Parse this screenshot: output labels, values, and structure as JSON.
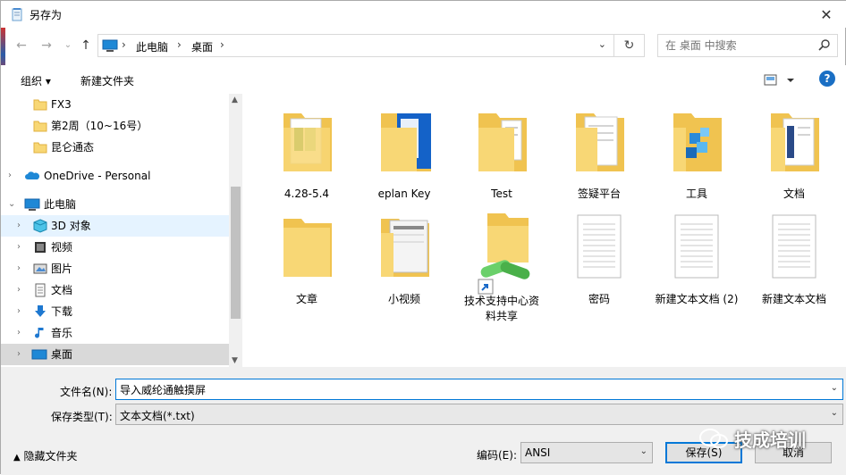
{
  "window": {
    "title": "另存为"
  },
  "address": {
    "crumbs": [
      "此电脑",
      "桌面"
    ],
    "search_placeholder": "在 桌面 中搜索"
  },
  "toolbar": {
    "organize_label": "组织 ▾",
    "new_folder_label": "新建文件夹",
    "help_label": "?"
  },
  "nav": {
    "items": [
      {
        "label": "FX3",
        "icon": "folder-icon"
      },
      {
        "label": "第2周（10~16号）",
        "icon": "folder-icon"
      },
      {
        "label": "昆仑通态",
        "icon": "folder-icon"
      },
      {
        "label": "OneDrive - Personal",
        "icon": "cloud-icon"
      },
      {
        "label": "此电脑",
        "icon": "pc-icon"
      },
      {
        "label": "3D 对象",
        "icon": "cube-icon"
      },
      {
        "label": "视频",
        "icon": "video-icon"
      },
      {
        "label": "图片",
        "icon": "picture-icon"
      },
      {
        "label": "文档",
        "icon": "document-icon"
      },
      {
        "label": "下载",
        "icon": "download-icon"
      },
      {
        "label": "音乐",
        "icon": "music-icon"
      },
      {
        "label": "桌面",
        "icon": "desktop-icon"
      }
    ]
  },
  "files": [
    {
      "label": "4.28-5.4",
      "type": "folder"
    },
    {
      "label": "eplan Key",
      "type": "folder"
    },
    {
      "label": "Test",
      "type": "folder"
    },
    {
      "label": "签疑平台",
      "type": "folder"
    },
    {
      "label": "工具",
      "type": "folder"
    },
    {
      "label": "文档",
      "type": "folder"
    },
    {
      "label": "文章",
      "type": "folder"
    },
    {
      "label": "小视频",
      "type": "folder"
    },
    {
      "label": "技术支持中心资料共享",
      "label_line1": "技术支持中心资",
      "label_line2": "料共享",
      "type": "shortcut"
    },
    {
      "label": "密码",
      "type": "text"
    },
    {
      "label": "新建文本文档 (2)",
      "type": "text"
    },
    {
      "label": "新建文本文档",
      "type": "text"
    }
  ],
  "save": {
    "filename_label": "文件名(N):",
    "filename_value": "导入威纶通触摸屏",
    "filetype_label": "保存类型(T):",
    "filetype_value": "文本文档(*.txt)",
    "hide_folders_label": "隐藏文件夹",
    "encoding_label": "编码(E):",
    "encoding_value": "ANSI",
    "save_label": "保存(S)",
    "cancel_label": "取消"
  },
  "watermark": {
    "text": "技成培训"
  },
  "colors": {
    "accent": "#0078d7",
    "selection": "#cce8ff",
    "folder": "#f8d775"
  }
}
